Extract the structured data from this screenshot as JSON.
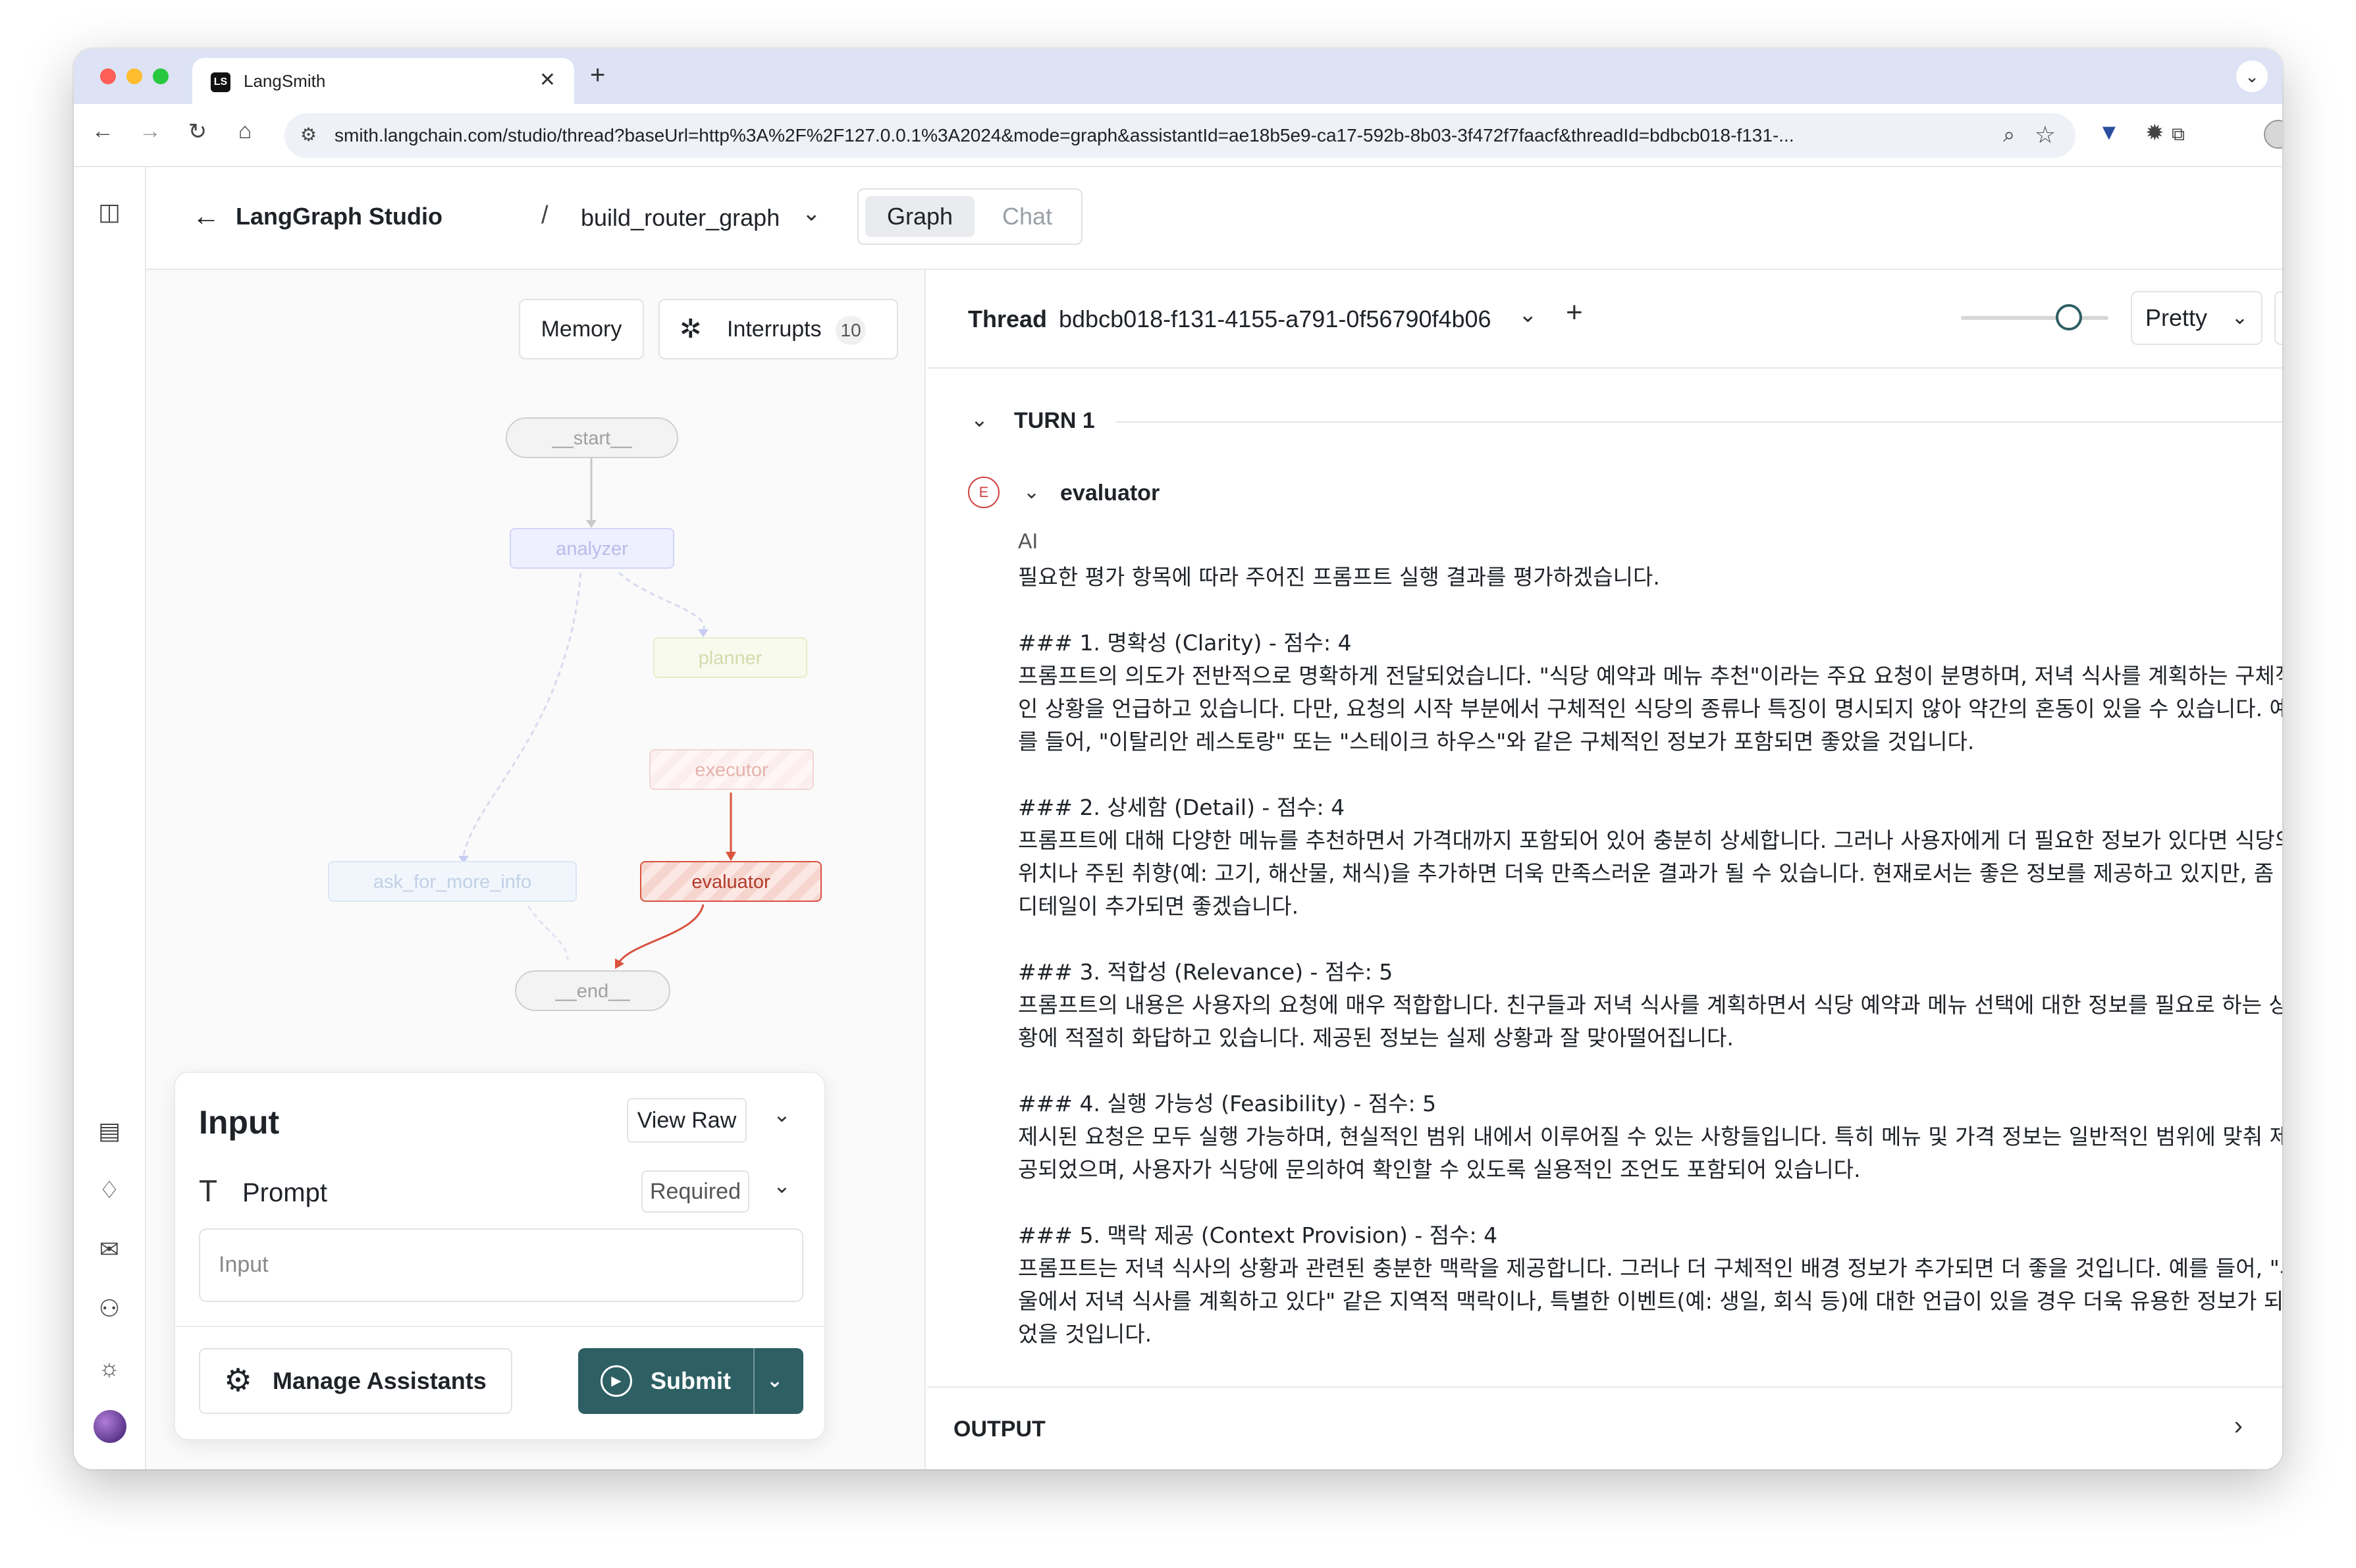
{
  "browser": {
    "tab_title": "LangSmith",
    "favicon": "LS",
    "url": "smith.langchain.com/studio/thread?baseUrl=http%3A%2F%2F127.0.0.1%3A2024&mode=graph&assistantId=ae18b5e9-ca17-592b-8b03-3f472f7faacf&threadId=bdbcb018-f131-..."
  },
  "header": {
    "app_title": "LangGraph Studio",
    "separator": "/",
    "graph_name": "build_router_graph",
    "tabs": [
      {
        "label": "Graph",
        "active": true
      },
      {
        "label": "Chat",
        "active": false
      }
    ]
  },
  "graph_panel": {
    "memory_label": "Memory",
    "interrupts_label": "Interrupts",
    "interrupts_count": "10",
    "nodes": {
      "start": "__start__",
      "analyzer": "analyzer",
      "planner": "planner",
      "executor": "executor",
      "ask_for_more_info": "ask_for_more_info",
      "evaluator": "evaluator",
      "end": "__end__"
    }
  },
  "input_card": {
    "title": "Input",
    "view_raw": "View Raw",
    "field_label": "Prompt",
    "required": "Required",
    "input_placeholder": "Input",
    "manage_assistants": "Manage Assistants",
    "submit": "Submit"
  },
  "thread": {
    "label": "Thread",
    "id": "bdbcb018-f131-4155-a791-0f56790f4b06",
    "view_mode": "Pretty",
    "turn_label": "TURN 1",
    "node_badge": "E",
    "node_name": "evaluator",
    "role": "AI",
    "message": "필요한 평가 항목에 따라 주어진 프롬프트 실행 결과를 평가하겠습니다.\n\n### 1. 명확성 (Clarity) - 점수: 4\n프롬프트의 의도가 전반적으로 명확하게 전달되었습니다. \"식당 예약과 메뉴 추천\"이라는 주요 요청이 분명하며, 저녁 식사를 계획하는 구체적\n인 상황을 언급하고 있습니다. 다만, 요청의 시작 부분에서 구체적인 식당의 종류나 특징이 명시되지 않아 약간의 혼동이 있을 수 있습니다. 예\n를 들어, \"이탈리안 레스토랑\" 또는 \"스테이크 하우스\"와 같은 구체적인 정보가 포함되면 좋았을 것입니다.\n\n### 2. 상세함 (Detail) - 점수: 4\n프롬프트에 대해 다양한 메뉴를 추천하면서 가격대까지 포함되어 있어 충분히 상세합니다. 그러나 사용자에게 더 필요한 정보가 있다면 식당의\n위치나 주된 취향(예: 고기, 해산물, 채식)을 추가하면 더욱 만족스러운 결과가 될 수 있습니다. 현재로서는 좋은 정보를 제공하고 있지만, 좀 더\n디테일이 추가되면 좋겠습니다.\n\n### 3. 적합성 (Relevance) - 점수: 5\n프롬프트의 내용은 사용자의 요청에 매우 적합합니다. 친구들과 저녁 식사를 계획하면서 식당 예약과 메뉴 선택에 대한 정보를 필요로 하는 상\n황에 적절히 화답하고 있습니다. 제공된 정보는 실제 상황과 잘 맞아떨어집니다.\n\n### 4. 실행 가능성 (Feasibility) - 점수: 5\n제시된 요청은 모두 실행 가능하며, 현실적인 범위 내에서 이루어질 수 있는 사항들입니다. 특히 메뉴 및 가격 정보는 일반적인 범위에 맞춰 제\n공되었으며, 사용자가 식당에 문의하여 확인할 수 있도록 실용적인 조언도 포함되어 있습니다.\n\n### 5. 맥락 제공 (Context Provision) - 점수: 4\n프롬프트는 저녁 식사의 상황과 관련된 충분한 맥락을 제공합니다. 그러나 더 구체적인 배경 정보가 추가되면 더 좋을 것입니다. 예를 들어, \"서\n울에서 저녁 식사를 계획하고 있다\" 같은 지역적 맥락이나, 특별한 이벤트(예: 생일, 회식 등)에 대한 언급이 있을 경우 더욱 유용한 정보가 되\n었을 것입니다.",
    "output_label": "OUTPUT"
  },
  "colors": {
    "accent": "#2d5f63",
    "evaluator": "#d9533f",
    "badge_red": "#d14343"
  },
  "icons": {
    "rail": [
      "sidebar-toggle-icon",
      "document-icon",
      "bell-icon",
      "mail-icon",
      "user-add-icon",
      "sun-icon"
    ],
    "browser": [
      "back-icon",
      "forward-icon",
      "reload-icon",
      "home-icon",
      "site-settings-icon",
      "zoom-icon",
      "star-icon",
      "extension-icon"
    ]
  }
}
